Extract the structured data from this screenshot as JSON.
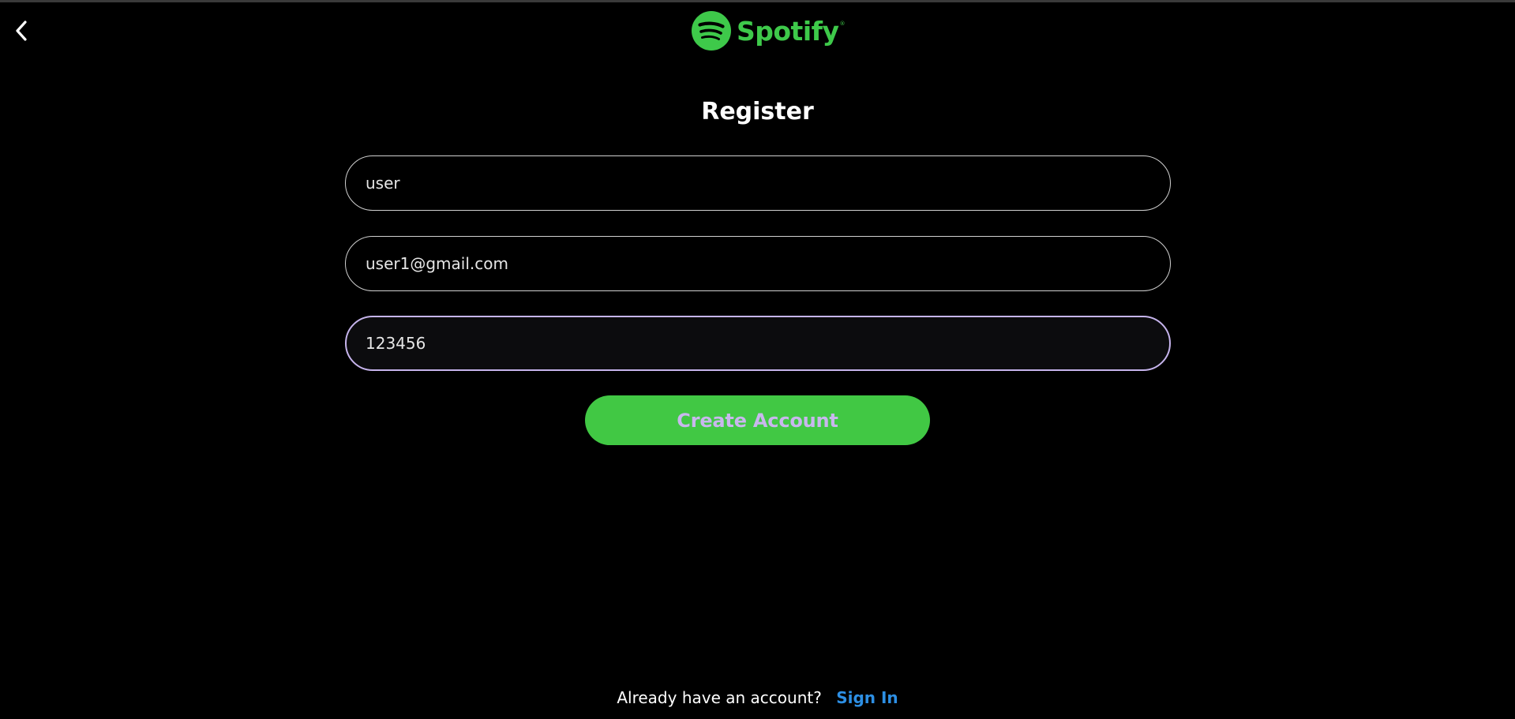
{
  "header": {
    "back_icon": "chevron-left-icon",
    "logo_icon": "spotify-logo-icon",
    "logo_text": "Spotify"
  },
  "form": {
    "title": "Register",
    "username_value": "user",
    "email_value": "user1@gmail.com",
    "password_value": "123456",
    "submit_label": "Create Account"
  },
  "footer": {
    "prompt_text": "Already have an account?",
    "signin_label": "Sign In"
  },
  "colors": {
    "background": "#000000",
    "brand_green": "#41c844",
    "focus_border": "#c6b4ec",
    "link_blue": "#2d8fe4"
  }
}
